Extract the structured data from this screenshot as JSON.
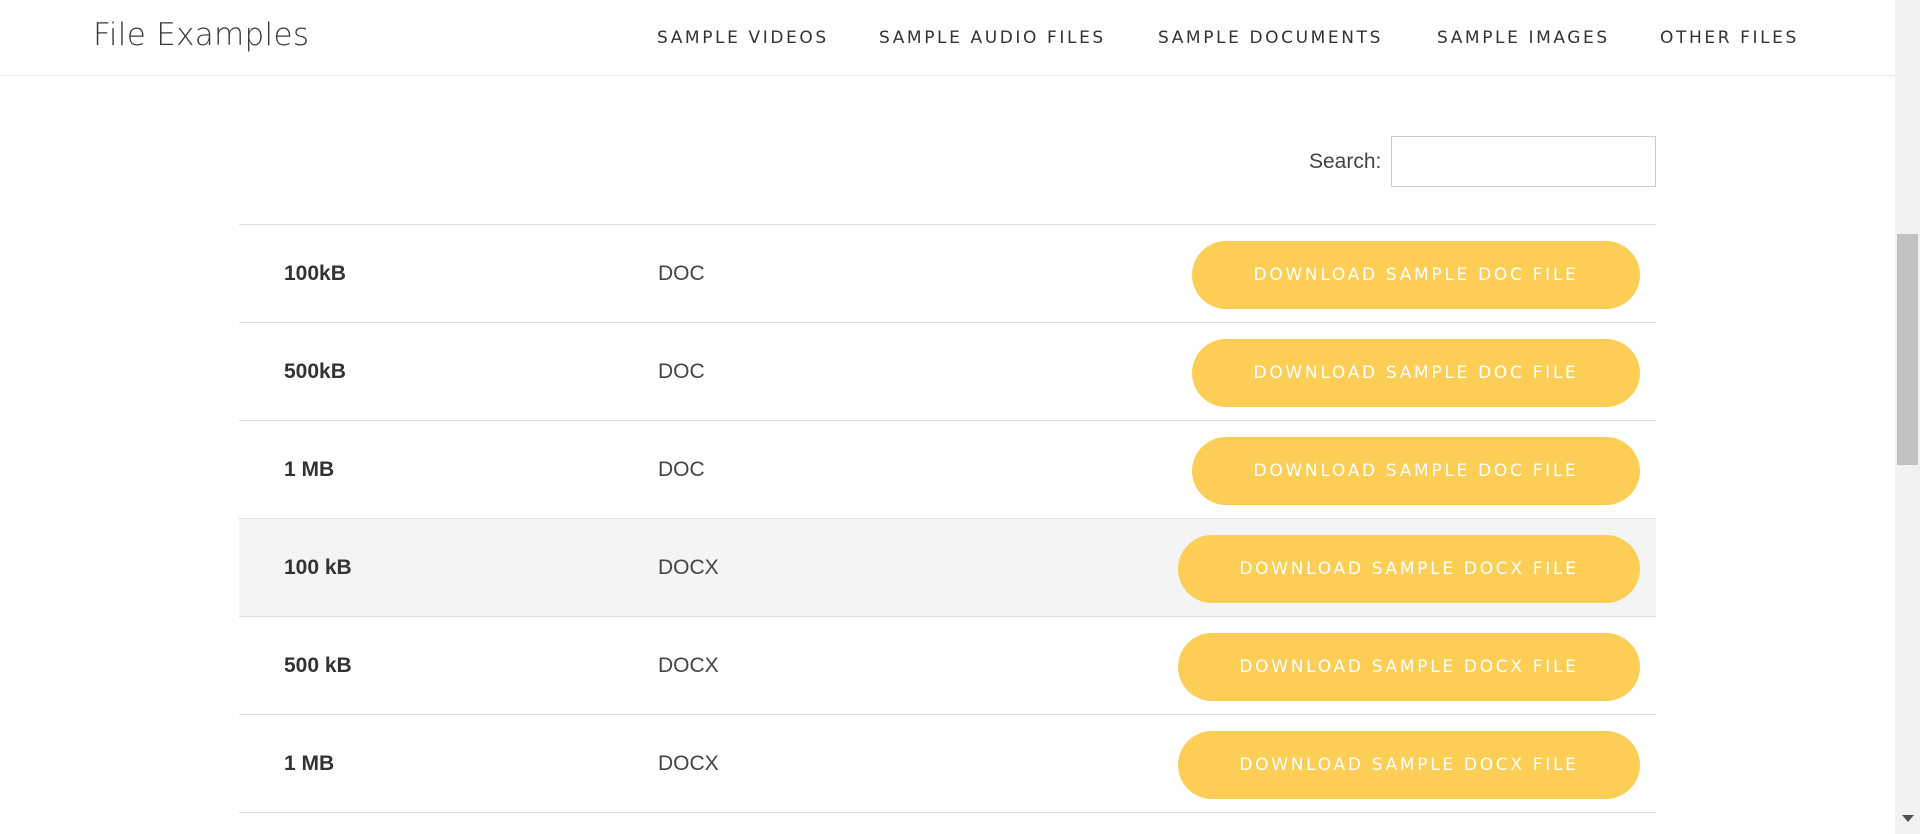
{
  "header": {
    "logo": "File Examples",
    "nav": [
      {
        "label": "SAMPLE VIDEOS"
      },
      {
        "label": "SAMPLE AUDIO FILES"
      },
      {
        "label": "SAMPLE DOCUMENTS"
      },
      {
        "label": "SAMPLE IMAGES"
      },
      {
        "label": "OTHER FILES"
      }
    ]
  },
  "search": {
    "label": "Search:",
    "value": ""
  },
  "table": {
    "rows": [
      {
        "size": "100kB",
        "type": "DOC",
        "button": "DOWNLOAD SAMPLE DOC FILE"
      },
      {
        "size": "500kB",
        "type": "DOC",
        "button": "DOWNLOAD SAMPLE DOC FILE"
      },
      {
        "size": "1 MB",
        "type": "DOC",
        "button": "DOWNLOAD SAMPLE DOC FILE"
      },
      {
        "size": "100 kB",
        "type": "DOCX",
        "button": "DOWNLOAD SAMPLE DOCX FILE"
      },
      {
        "size": "500 kB",
        "type": "DOCX",
        "button": "DOWNLOAD SAMPLE DOCX FILE"
      },
      {
        "size": "1 MB",
        "type": "DOCX",
        "button": "DOWNLOAD SAMPLE DOCX FILE"
      }
    ]
  },
  "colors": {
    "button": "#fcce56",
    "button_text": "#ffffff",
    "hover_row": "#f4f4f4"
  }
}
